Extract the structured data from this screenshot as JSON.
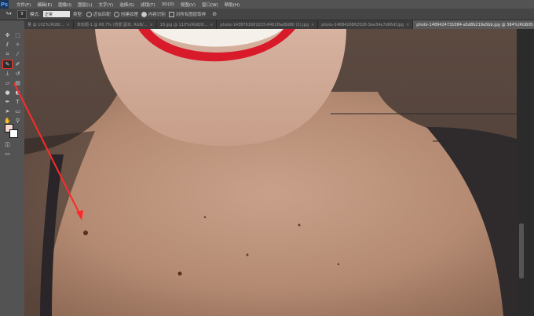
{
  "app": {
    "logo": "Ps"
  },
  "menu": [
    "文件(F)",
    "编辑(E)",
    "图像(I)",
    "图层(L)",
    "文字(Y)",
    "选择(S)",
    "滤镜(T)",
    "3D(D)",
    "视图(V)",
    "窗口(W)",
    "帮助(H)"
  ],
  "options": {
    "brush_size": "9",
    "mode_label": "模式:",
    "mode_value": "正常",
    "type_label": "类型:",
    "radio1": "近似匹配",
    "radio2": "创建纹理",
    "radio3": "内容识别",
    "check1": "对所有图层取样"
  },
  "tabs": [
    {
      "label": "量 @ 102%(RGB/..."
    },
    {
      "label": "未标题-1 @ 66.7% (背景 副本, RGB/..."
    },
    {
      "label": "18.jpg @ 113%(RGB/8..."
    },
    {
      "label": "photo-1438761681033-6461ffad8d80 (1).jpg"
    },
    {
      "label": "photo-1488426862026-3ee34a7d66df.jpg"
    },
    {
      "label": "photo-1489424731084-a5d8b219a5bb.jpg @ 384%(RGB/8)"
    }
  ],
  "colors": {
    "foreground": "#ffffff",
    "background": "#f4d6d2",
    "annotation": "#ff2a2a"
  }
}
